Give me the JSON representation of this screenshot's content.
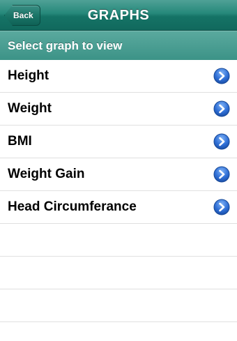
{
  "navbar": {
    "back_label": "Back",
    "title": "GRAPHS"
  },
  "section": {
    "header": "Select graph to view"
  },
  "rows": [
    {
      "label": "Height",
      "icon": "chevron-right-circle-icon"
    },
    {
      "label": "Weight",
      "icon": "chevron-right-circle-icon"
    },
    {
      "label": "BMI",
      "icon": "chevron-right-circle-icon"
    },
    {
      "label": "Weight Gain",
      "icon": "chevron-right-circle-icon"
    },
    {
      "label": "Head Circumferance",
      "icon": "chevron-right-circle-icon"
    }
  ],
  "colors": {
    "navbar": "#157366",
    "section_header": "#4a9e92",
    "disclosure_blue": "#2f6fd6"
  }
}
